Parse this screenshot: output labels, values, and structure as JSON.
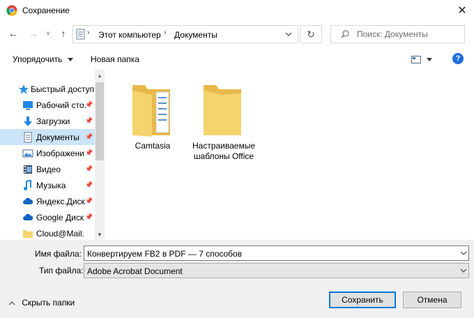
{
  "window": {
    "title": "Сохранение",
    "close_glyph": "✕"
  },
  "nav": {
    "back_glyph": "←",
    "forward_glyph": "→",
    "recent_glyph": "˅",
    "up_glyph": "↑",
    "refresh_glyph": "↻",
    "breadcrumb": [
      "Этот компьютер",
      "Документы"
    ],
    "search_placeholder": "Поиск: Документы"
  },
  "toolbar": {
    "organize_label": "Упорядочить",
    "new_folder_label": "Новая папка",
    "help_glyph": "?"
  },
  "sidebar": {
    "items": [
      {
        "label": "Быстрый доступ",
        "icon": "star-icon",
        "pinned": false,
        "selected": false
      },
      {
        "label": "Рабочий сто.",
        "icon": "desktop-icon",
        "pinned": true,
        "selected": false
      },
      {
        "label": "Загрузки",
        "icon": "download-icon",
        "pinned": true,
        "selected": false
      },
      {
        "label": "Документы",
        "icon": "document-icon",
        "pinned": true,
        "selected": true
      },
      {
        "label": "Изображени",
        "icon": "image-icon",
        "pinned": true,
        "selected": false
      },
      {
        "label": "Видео",
        "icon": "video-icon",
        "pinned": true,
        "selected": false
      },
      {
        "label": "Музыка",
        "icon": "music-icon",
        "pinned": true,
        "selected": false
      },
      {
        "label": "Яндекс.Диск",
        "icon": "cloud-icon",
        "pinned": true,
        "selected": false
      },
      {
        "label": "Google Диск",
        "icon": "cloud-icon",
        "pinned": true,
        "selected": false
      },
      {
        "label": "Cloud@Mail.",
        "icon": "folder-icon",
        "pinned": false,
        "selected": false
      }
    ]
  },
  "files": [
    {
      "name": "Camtasia",
      "icon": "folder-with-documents-icon"
    },
    {
      "name": "Настраиваемые шаблоны Office",
      "icon": "folder-icon"
    }
  ],
  "form": {
    "filename_label": "Имя файла:",
    "filename_value": "Конвертируем FB2 в PDF — 7 способов",
    "filetype_label": "Тип файла:",
    "filetype_value": "Adobe Acrobat Document"
  },
  "footer": {
    "hide_folders_label": "Скрыть папки",
    "save_label": "Сохранить",
    "cancel_label": "Отмена"
  },
  "colors": {
    "accent": "#0078d7",
    "selection": "#cce4f7",
    "folder": "#f5d36d"
  }
}
